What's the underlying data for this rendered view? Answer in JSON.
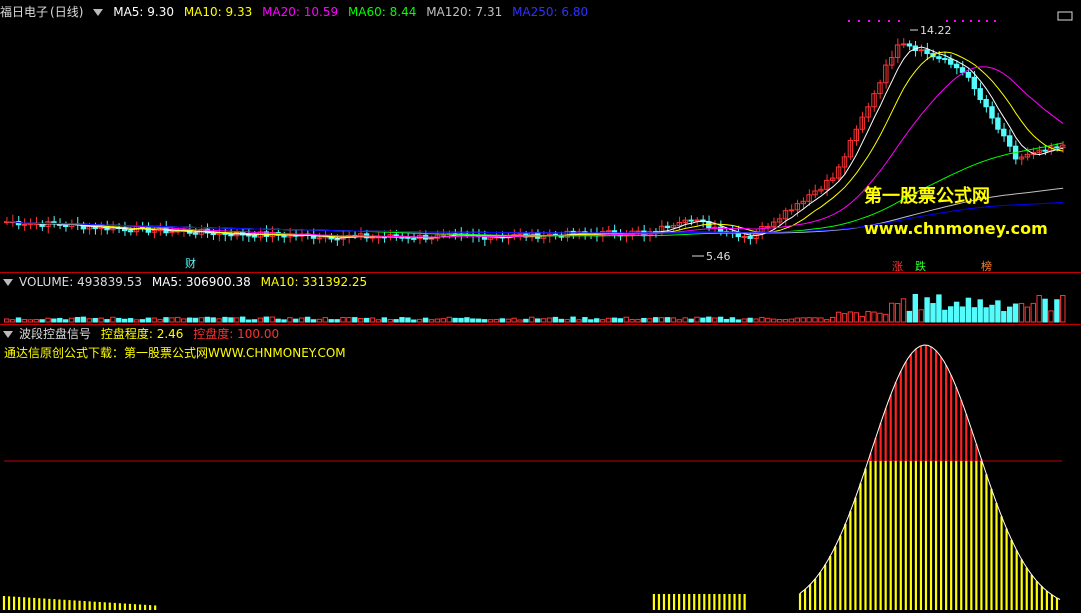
{
  "kline_header": {
    "stock": "福日电子",
    "period": "(日线)",
    "ma5": "MA5: 9.30",
    "ma10": "MA10: 9.33",
    "ma20": "MA20: 10.59",
    "ma60": "MA60: 8.44",
    "ma120": "MA120: 7.31",
    "ma250": "MA250: 6.80"
  },
  "price_labels": {
    "high": "14.22",
    "low": "5.46"
  },
  "markers": {
    "cai": "财",
    "zhang": "涨",
    "die": "跌",
    "bang": "榜"
  },
  "watermark": {
    "title": "第一股票公式网",
    "url": "www.chnmoney.com"
  },
  "volume_header": {
    "volume": "VOLUME: 493839.53",
    "ma5": "MA5: 306900.38",
    "ma10": "MA10: 331392.25"
  },
  "indicator_header": {
    "name": "波段控盘信号",
    "degree": "控盘程度: 2.46",
    "control": "控盘度: 100.00",
    "note": "通达信原创公式下载：第一股票公式网WWW.CHNMONEY.COM"
  },
  "colors": {
    "ma5": "#ffffff",
    "ma10": "#ffff00",
    "ma20": "#ff00ff",
    "ma60": "#00ff00",
    "ma120": "#c0c0c0",
    "ma250": "#0000ff",
    "up": "#ff3232",
    "down": "#54fcfc",
    "divider": "#c00000"
  }
}
